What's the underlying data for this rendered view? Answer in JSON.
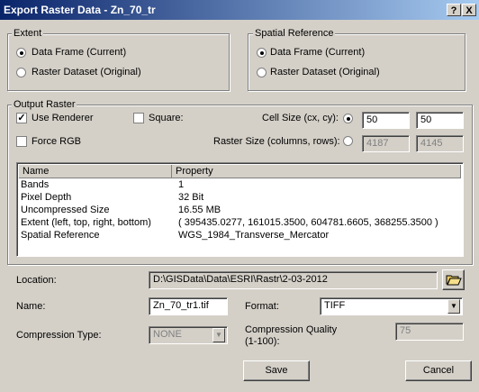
{
  "window": {
    "title": "Export Raster Data - Zn_70_tr",
    "help_label": "?",
    "close_label": "X"
  },
  "extent": {
    "legend": "Extent",
    "options": [
      {
        "label": "Data Frame (Current)",
        "selected": true
      },
      {
        "label": "Raster Dataset (Original)",
        "selected": false
      }
    ]
  },
  "spatial_reference": {
    "legend": "Spatial Reference",
    "options": [
      {
        "label": "Data Frame (Current)",
        "selected": true
      },
      {
        "label": "Raster Dataset (Original)",
        "selected": false
      }
    ]
  },
  "output_raster": {
    "legend": "Output Raster",
    "use_renderer": {
      "label": "Use Renderer",
      "checked": true
    },
    "square": {
      "label": "Square:",
      "checked": false
    },
    "force_rgb": {
      "label": "Force RGB",
      "checked": false
    },
    "cell_size": {
      "label": "Cell Size (cx, cy):",
      "selected": true,
      "cx": "50",
      "cy": "50"
    },
    "raster_size": {
      "label": "Raster Size (columns, rows):",
      "selected": false,
      "columns": "4187",
      "rows": "4145"
    },
    "table": {
      "headers": [
        "Name",
        "Property"
      ],
      "rows": [
        [
          "Bands",
          "1"
        ],
        [
          "Pixel Depth",
          "32 Bit"
        ],
        [
          "Uncompressed Size",
          "16.55 MB"
        ],
        [
          "Extent (left, top, right, bottom)",
          "( 395435.0277, 161015.3500, 604781.6605, 368255.3500 )"
        ],
        [
          "Spatial Reference",
          "WGS_1984_Transverse_Mercator"
        ]
      ]
    }
  },
  "location": {
    "label": "Location:",
    "value": "D:\\GISData\\Data\\ESRI\\Rastr\\2-03-2012"
  },
  "name": {
    "label": "Name:",
    "value": "Zn_70_tr1.tif"
  },
  "format": {
    "label": "Format:",
    "value": "TIFF"
  },
  "compression_type": {
    "label": "Compression Type:",
    "value": "NONE"
  },
  "compression_quality": {
    "label_line1": "Compression Quality",
    "label_line2": "(1-100):",
    "value": "75"
  },
  "buttons": {
    "save": "Save",
    "cancel": "Cancel"
  }
}
